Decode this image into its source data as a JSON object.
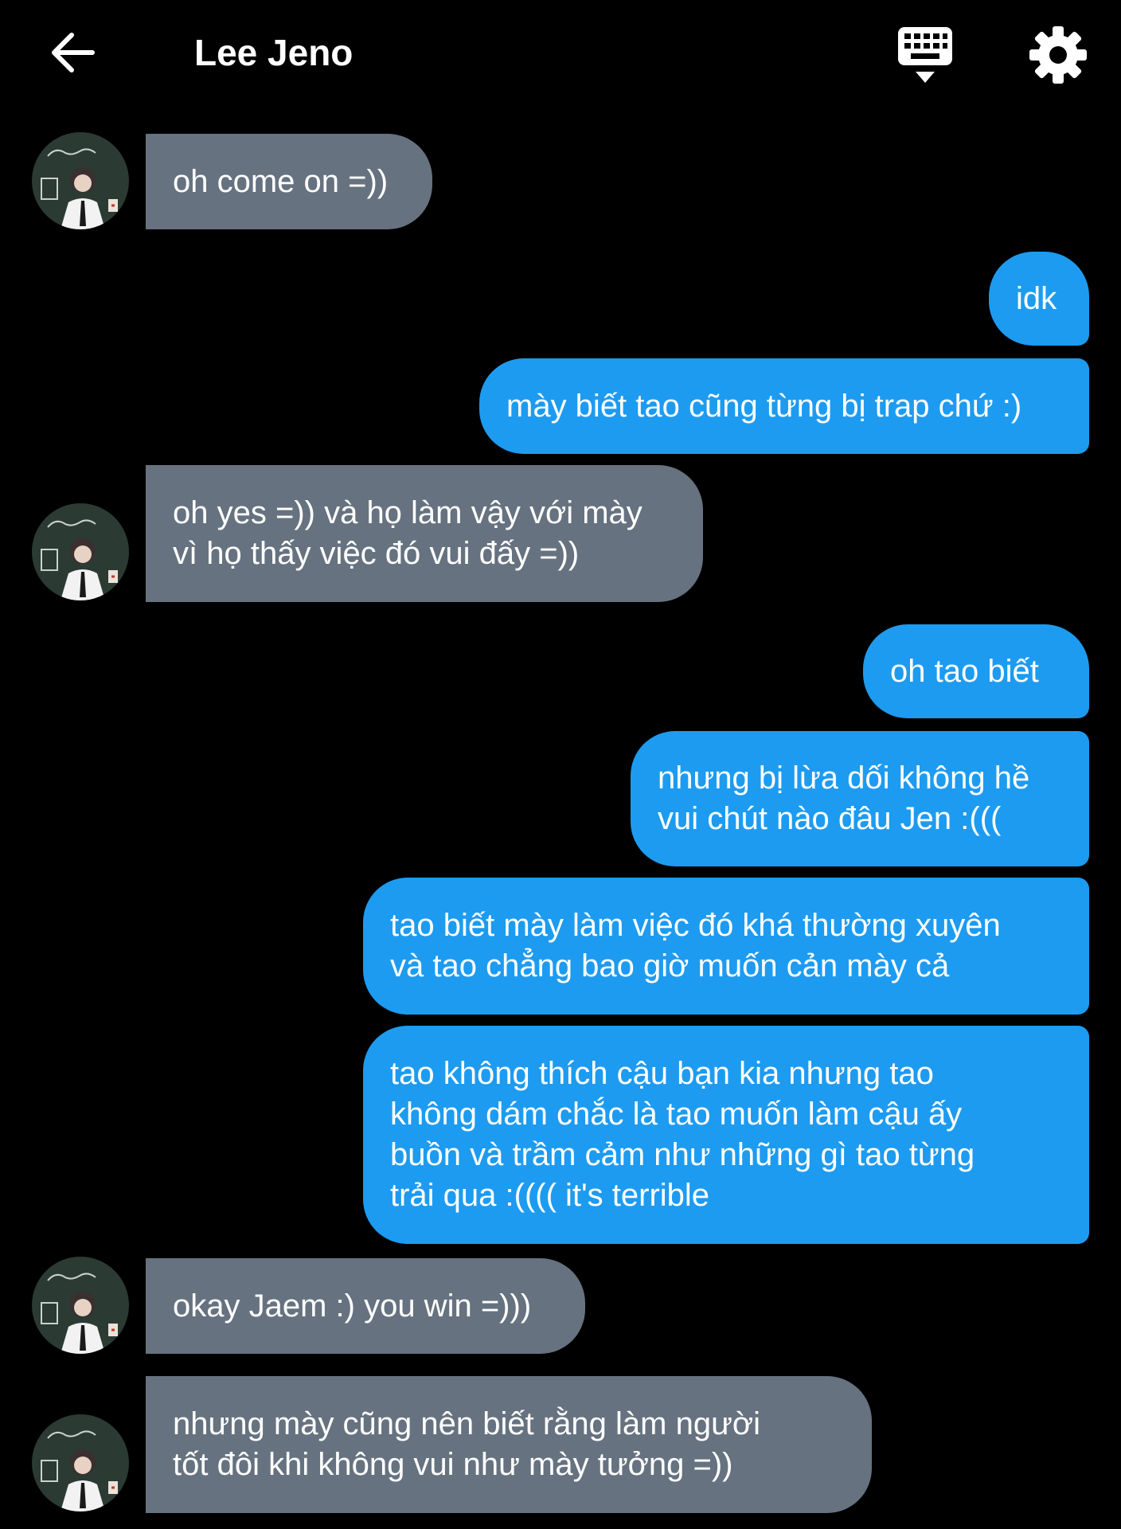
{
  "header": {
    "title": "Lee Jeno",
    "back_icon": "arrow-left-icon",
    "keyboard_icon": "keyboard-icon",
    "settings_icon": "gear-icon"
  },
  "colors": {
    "background": "#000000",
    "incoming_bubble": "#66727f",
    "outgoing_bubble": "#1d9bf0",
    "text": "#ffffff"
  },
  "messages": [
    {
      "sender": "Lee Jeno",
      "direction": "incoming",
      "text": "oh come on =))"
    },
    {
      "sender": "me",
      "direction": "outgoing",
      "text": "idk"
    },
    {
      "sender": "me",
      "direction": "outgoing",
      "text": "mày biết tao cũng từng bị trap chứ :)"
    },
    {
      "sender": "Lee Jeno",
      "direction": "incoming",
      "text": "oh yes =)) và họ làm vậy với mày\nvì họ thấy việc đó vui đấy =))"
    },
    {
      "sender": "me",
      "direction": "outgoing",
      "text": "oh tao biết"
    },
    {
      "sender": "me",
      "direction": "outgoing",
      "text": "nhưng bị lừa dối không hề\nvui chút nào đâu Jen :((("
    },
    {
      "sender": "me",
      "direction": "outgoing",
      "text": "tao biết mày làm việc đó khá thường xuyên\nvà tao chẳng bao giờ muốn cản mày cả"
    },
    {
      "sender": "me",
      "direction": "outgoing",
      "text": "tao không thích cậu bạn kia nhưng tao\nkhông dám chắc là tao muốn làm cậu ấy\nbuồn và trầm cảm như những gì tao từng\ntrải qua :(((( it's terrible"
    },
    {
      "sender": "Lee Jeno",
      "direction": "incoming",
      "text": "okay Jaem :) you win =)))"
    },
    {
      "sender": "Lee Jeno",
      "direction": "incoming",
      "text": "nhưng mày cũng nên biết rằng làm người\ntốt đôi khi không vui như mày tưởng =))"
    }
  ]
}
